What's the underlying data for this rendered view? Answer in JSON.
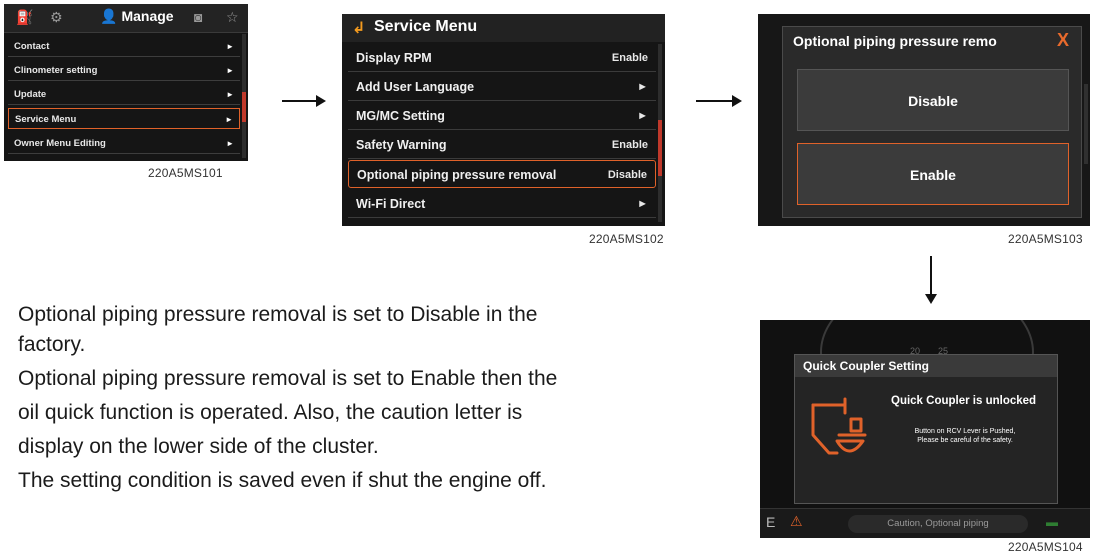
{
  "screen1": {
    "topbar_title": "Manage",
    "icons": [
      "gauge-icon",
      "gear-icon",
      "person-icon",
      "camera-icon",
      "star-icon"
    ],
    "items": [
      {
        "label": "Contact",
        "arrow": "►"
      },
      {
        "label": "Clinometer setting",
        "arrow": "►"
      },
      {
        "label": "Update",
        "arrow": "►"
      },
      {
        "label": "Service Menu",
        "arrow": "►",
        "selected": true
      },
      {
        "label": "Owner Menu Editing",
        "arrow": "►"
      }
    ],
    "caption": "220A5MS101"
  },
  "screen2": {
    "back_glyph": "↲",
    "title": "Service Menu",
    "items": [
      {
        "label": "Display RPM",
        "value": "Enable"
      },
      {
        "label": "Add User Language",
        "value": "►"
      },
      {
        "label": "MG/MC Setting",
        "value": "►"
      },
      {
        "label": "Safety Warning",
        "value": "Enable"
      },
      {
        "label": "Optional piping pressure removal",
        "value": "Disable",
        "selected": true
      },
      {
        "label": "Wi-Fi Direct",
        "value": "►"
      }
    ],
    "caption": "220A5MS102"
  },
  "screen3": {
    "title": "Optional piping pressure remo",
    "close_glyph": "X",
    "options": [
      {
        "label": "Disable"
      },
      {
        "label": "Enable",
        "selected": true
      }
    ],
    "caption": "220A5MS103"
  },
  "screen4": {
    "dialog_title": "Quick Coupler Setting",
    "status": "Quick Coupler is unlocked",
    "message_line1": "Button on RCV Lever is Pushed,",
    "message_line2": "Please be careful of the safety.",
    "caution": "Caution, Optional piping",
    "gauge_numbers": [
      "20",
      "25"
    ],
    "bottom_letter": "E",
    "caption": "220A5MS104",
    "accent_color": "#e0622a"
  },
  "body": {
    "lines": [
      "Optional piping pressure removal is set to Disable in the",
      "factory.",
      "Optional piping pressure removal is set to Enable then the",
      "oil quick function is operated. Also, the caution letter is",
      "display on the lower side of the cluster.",
      "The setting condition is saved even if shut the engine off."
    ]
  }
}
